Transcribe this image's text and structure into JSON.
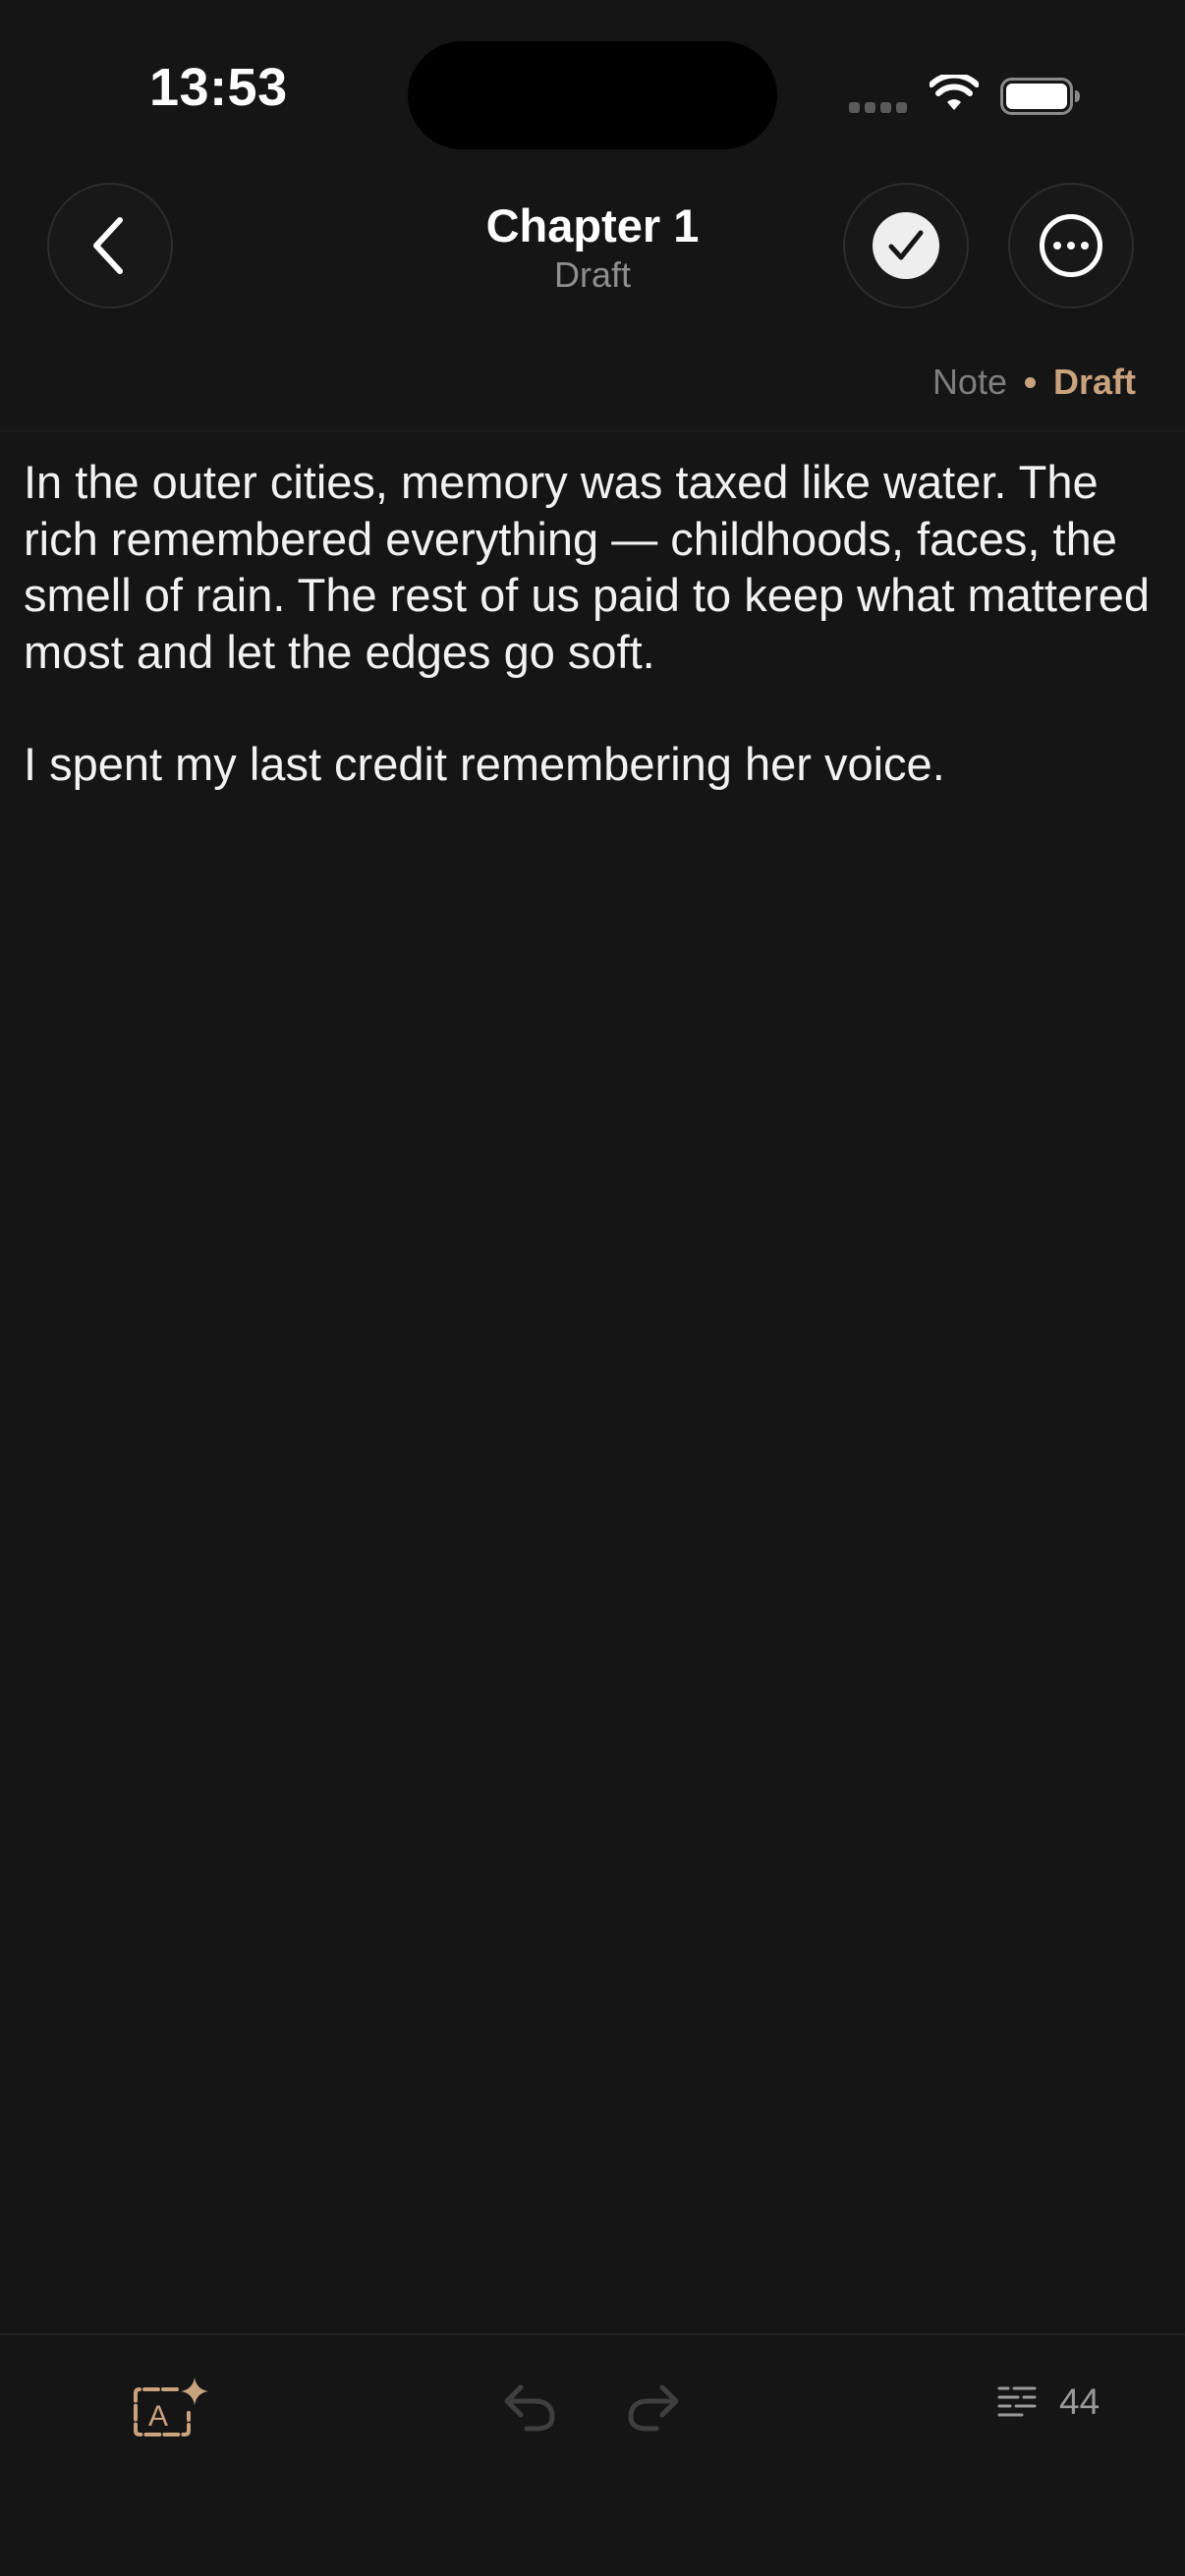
{
  "status_bar": {
    "time": "13:53"
  },
  "header": {
    "title": "Chapter 1",
    "subtitle": "Draft"
  },
  "tags": {
    "type": "Note",
    "status": "Draft"
  },
  "editor": {
    "paragraphs": [
      "In the outer cities, memory was taxed like water. The rich remembered everything — childhoods, faces, the smell of rain. The rest of us paid to keep what mattered most and let the edges go soft.",
      "I spent my last credit remembering her voice."
    ]
  },
  "toolbar": {
    "word_count": "44"
  },
  "colors": {
    "background": "#151515",
    "accent": "#c9a27e",
    "text": "#f2f2f2",
    "muted": "#8e8e8e"
  },
  "icons": [
    "chevron-left-icon",
    "checkmark-icon",
    "more-icon",
    "ai-text-sparkle-icon",
    "undo-icon",
    "redo-icon",
    "word-count-icon",
    "wifi-icon",
    "battery-icon",
    "signal-icon"
  ]
}
